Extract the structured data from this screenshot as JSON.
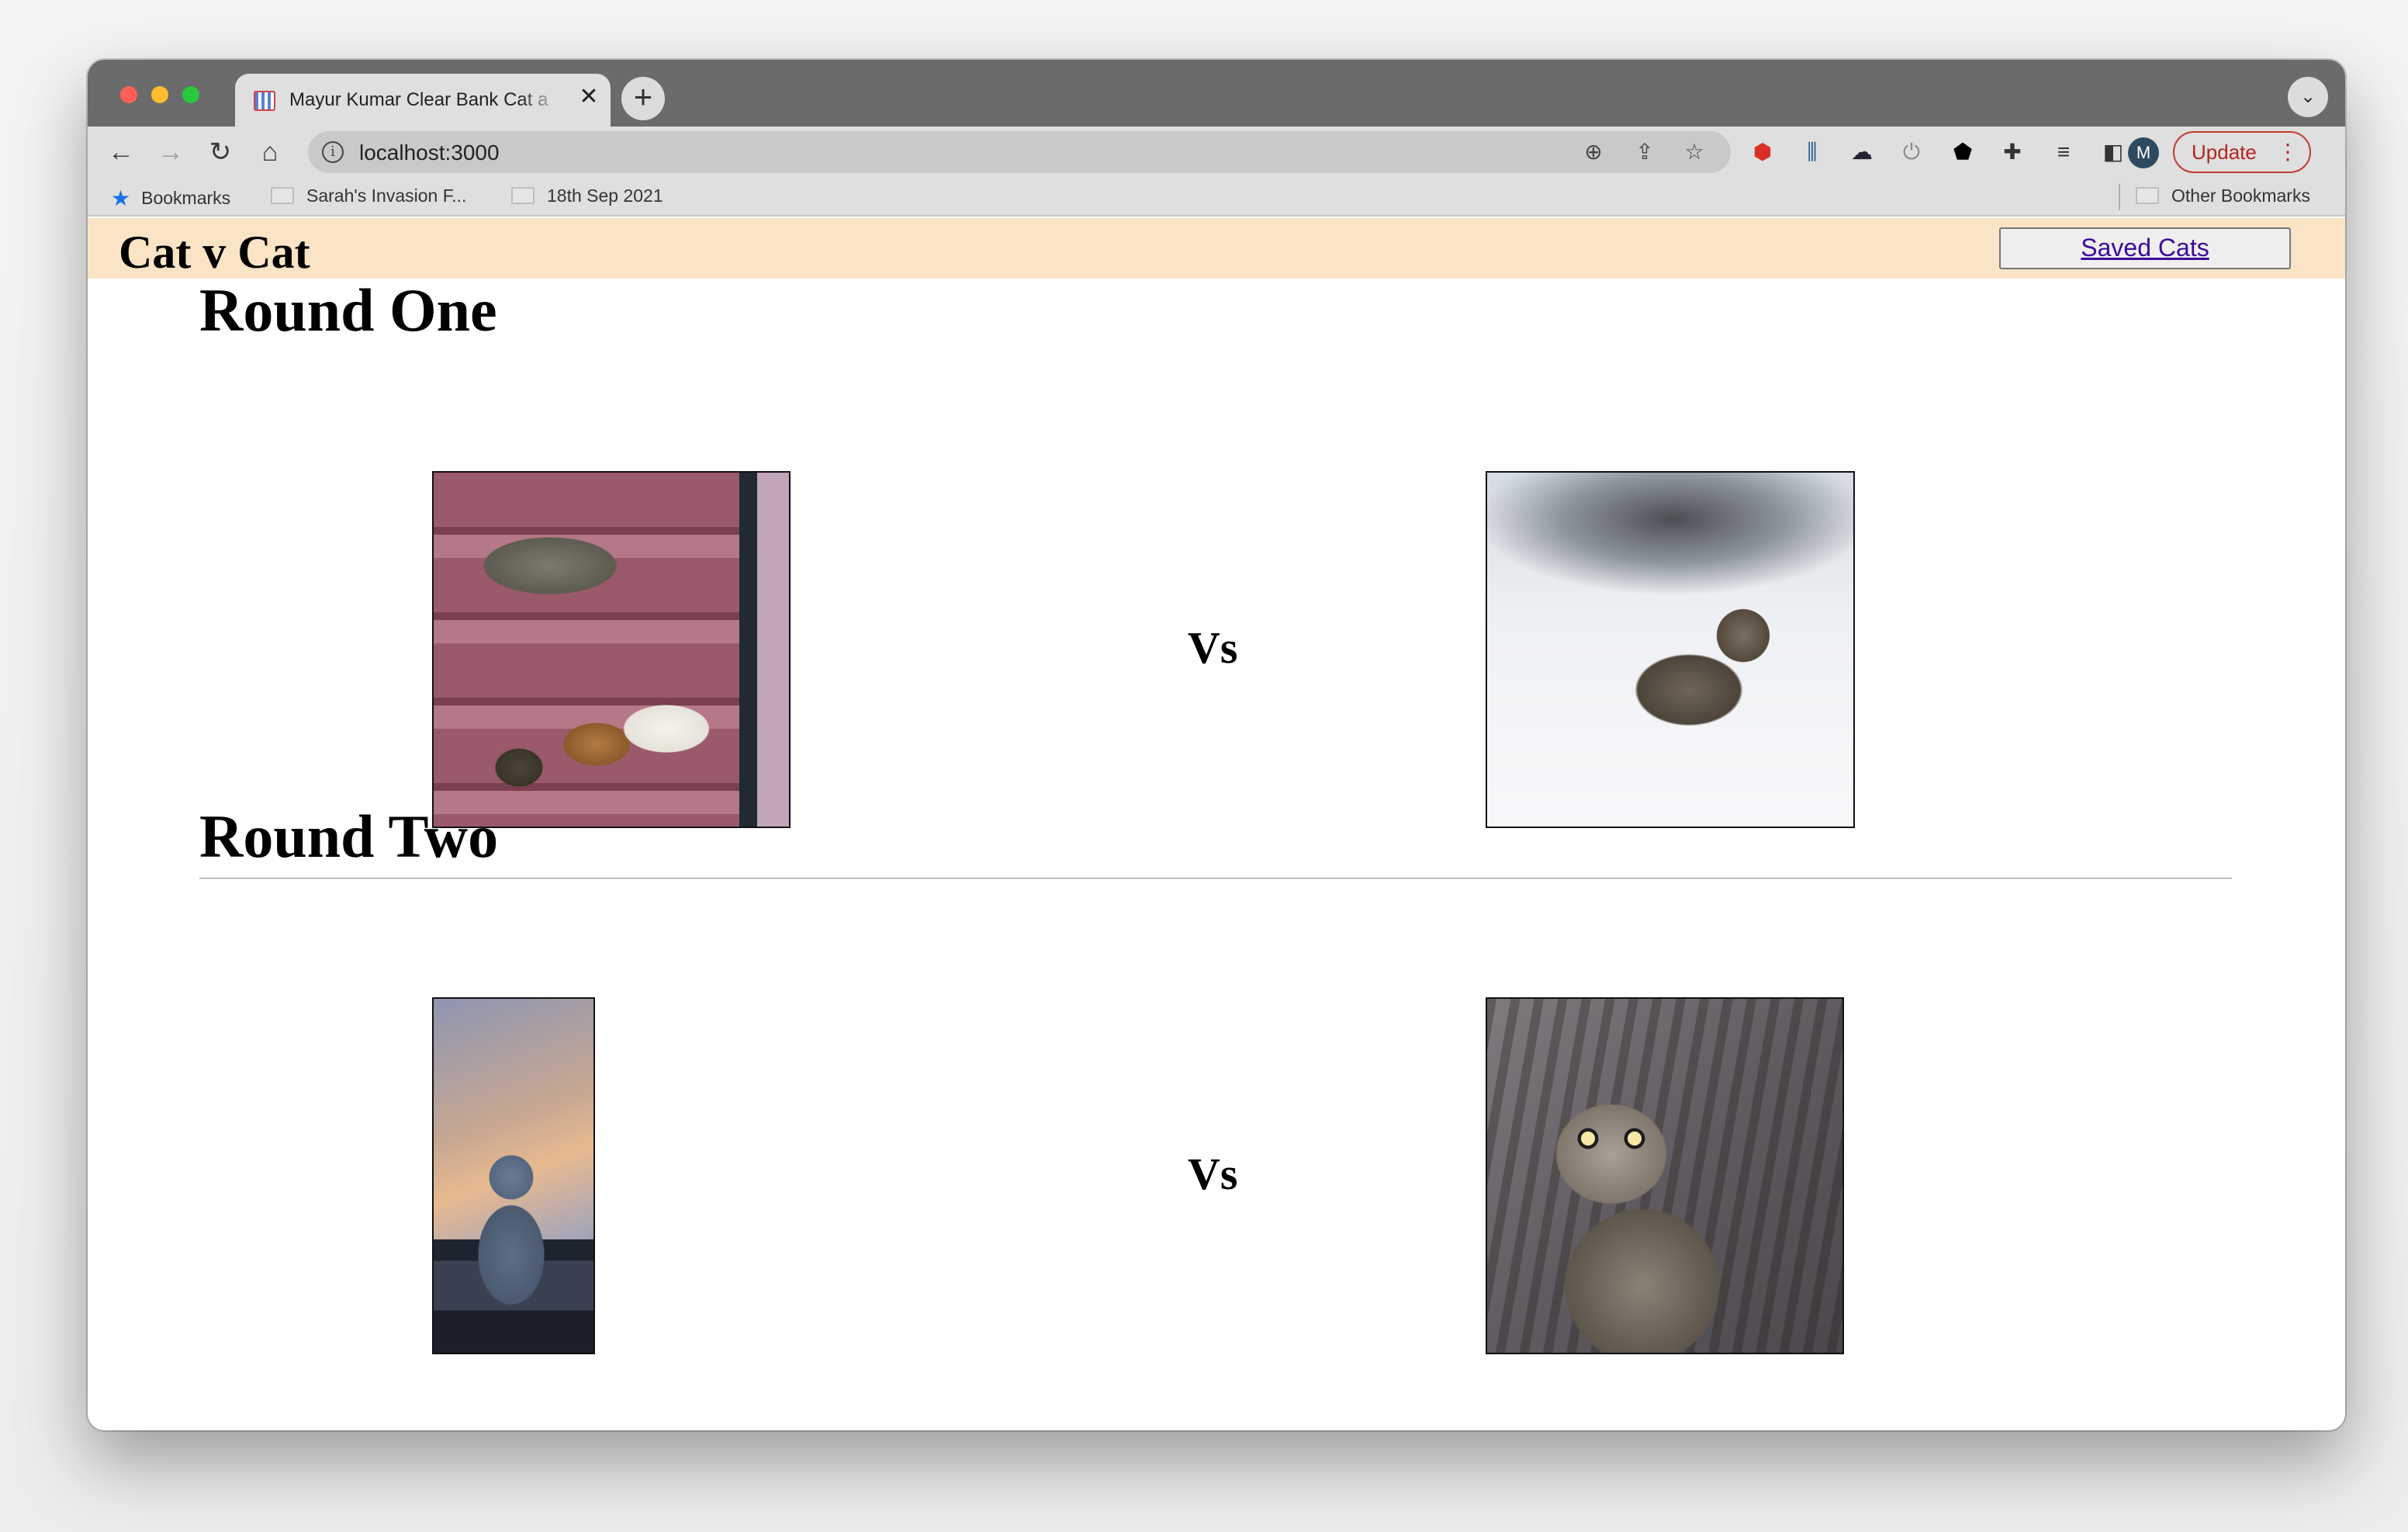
{
  "browser": {
    "tab_title": "Mayur Kumar Clear Bank Cat a",
    "url": "localhost:3000",
    "update_label": "Update",
    "avatar_letter": "M",
    "bookmarks": {
      "bookmarks_label": "Bookmarks",
      "items": [
        "Sarah's Invasion F...",
        "18th Sep 2021"
      ],
      "other_label": "Other Bookmarks"
    }
  },
  "app": {
    "title": "Cat v Cat",
    "saved_cats_label": "Saved Cats"
  },
  "rounds": [
    {
      "title": "Round One",
      "vs_label": "Vs"
    },
    {
      "title": "Round Two",
      "vs_label": "Vs"
    }
  ]
}
